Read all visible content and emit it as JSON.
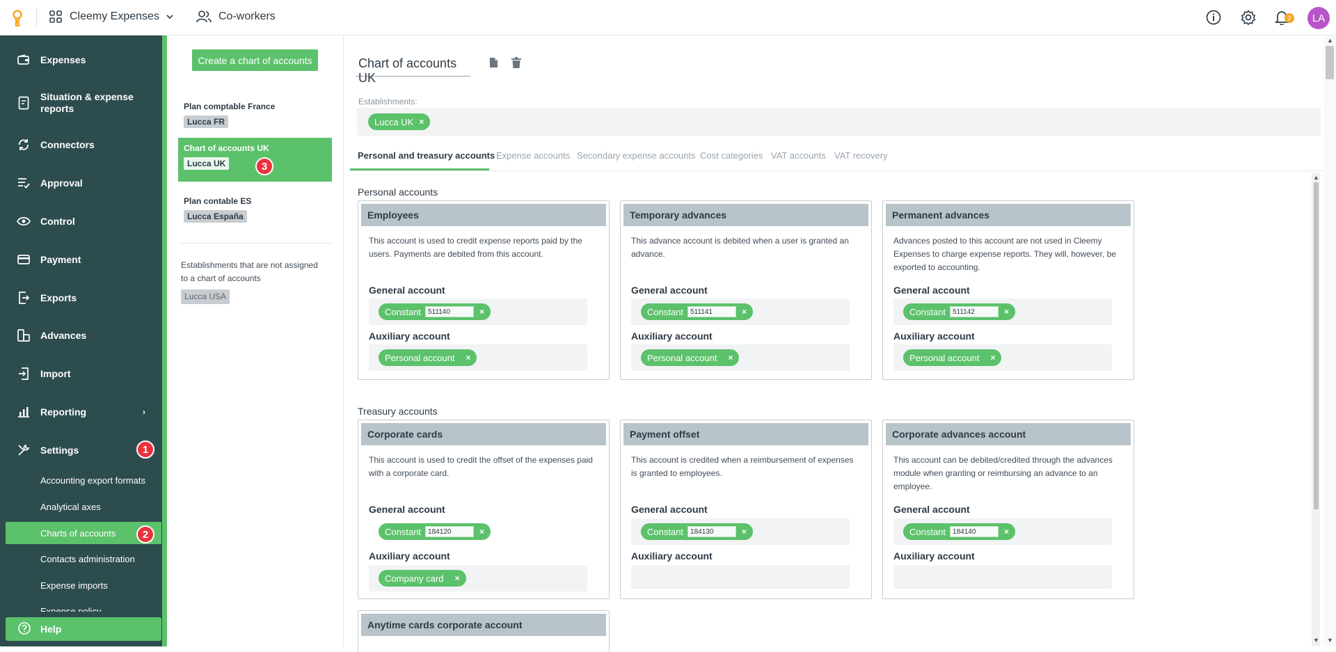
{
  "topbar": {
    "app_name": "Cleemy Expenses",
    "coworkers_label": "Co-workers",
    "notifications_count": "2",
    "avatar_initials": "LA"
  },
  "sidebar": {
    "items": [
      {
        "label": "Expenses",
        "icon": "wallet-icon"
      },
      {
        "label": "Situation & expense reports",
        "icon": "report-icon"
      },
      {
        "label": "Connectors",
        "icon": "sync-icon"
      },
      {
        "label": "Approval",
        "icon": "approval-icon"
      },
      {
        "label": "Control",
        "icon": "eye-icon"
      },
      {
        "label": "Payment",
        "icon": "card-icon"
      },
      {
        "label": "Exports",
        "icon": "export-icon"
      },
      {
        "label": "Advances",
        "icon": "advances-icon"
      },
      {
        "label": "Import",
        "icon": "import-icon"
      },
      {
        "label": "Reporting",
        "icon": "chart-icon"
      },
      {
        "label": "Settings",
        "icon": "tools-icon"
      }
    ],
    "sub_items": [
      {
        "label": "Accounting export formats"
      },
      {
        "label": "Analytical axes"
      },
      {
        "label": "Charts of accounts"
      },
      {
        "label": "Contacts administration"
      },
      {
        "label": "Expense imports"
      },
      {
        "label": "Expense policy"
      }
    ],
    "help_label": "Help",
    "markers": {
      "settings": "1",
      "charts": "2"
    }
  },
  "left_panel": {
    "create_button": "Create a chart of accounts",
    "plans": [
      {
        "name": "Plan comptable France",
        "tag": "Lucca FR"
      },
      {
        "name": "Chart of accounts UK",
        "tag": "Lucca UK"
      },
      {
        "name": "Plan contable ES",
        "tag": "Lucca España"
      }
    ],
    "marker_3": "3",
    "unassigned_text": "Establishments that are not assigned to a chart of accounts",
    "unassigned_tag": "Lucca USA"
  },
  "main": {
    "title": "Chart of accounts UK",
    "establishments_label": "Establishments:",
    "establishment_chip": "Lucca UK",
    "tabs": [
      {
        "label": "Personal and treasury accounts"
      },
      {
        "label": "Expense accounts"
      },
      {
        "label": "Secondary expense accounts"
      },
      {
        "label": "Cost categories"
      },
      {
        "label": "VAT accounts"
      },
      {
        "label": "VAT recovery"
      }
    ],
    "personal_title": "Personal accounts",
    "treasury_title": "Treasury accounts",
    "general_label": "General account",
    "auxiliary_label": "Auxiliary account",
    "constant_label": "Constant",
    "cards": [
      {
        "title": "Employees",
        "desc": "This account is used to credit expense reports paid by the users. Payments are debited from this account.",
        "general": "511140",
        "aux": "Personal account"
      },
      {
        "title": "Temporary advances",
        "desc": "This advance account is debited when a user is granted an advance.",
        "general": "511141",
        "aux": "Personal account"
      },
      {
        "title": "Permanent advances",
        "desc": "Advances posted to this account are not used in Cleemy Expenses to charge expense reports. They will, however, be exported to accounting.",
        "general": "511142",
        "aux": "Personal account"
      },
      {
        "title": "Corporate cards",
        "desc": "This account is used to credit the offset of the expenses paid with a corporate card.",
        "general": "184120",
        "aux": "Company card"
      },
      {
        "title": "Payment offset",
        "desc": "This account is credited when a reimbursement of expenses is granted to employees.",
        "general": "184130",
        "aux": ""
      },
      {
        "title": "Corporate advances account",
        "desc": "This account can be debited/credited through the advances module when granting or reimbursing an advance to an employee.",
        "general": "184140",
        "aux": ""
      },
      {
        "title": "Anytime cards corporate account",
        "desc": "",
        "general": "",
        "aux": ""
      }
    ]
  },
  "colors": {
    "sidebar": "#2d4c4e",
    "accent": "#5cc16b",
    "highlight": "#f5f500",
    "marker": "#e8323c"
  }
}
